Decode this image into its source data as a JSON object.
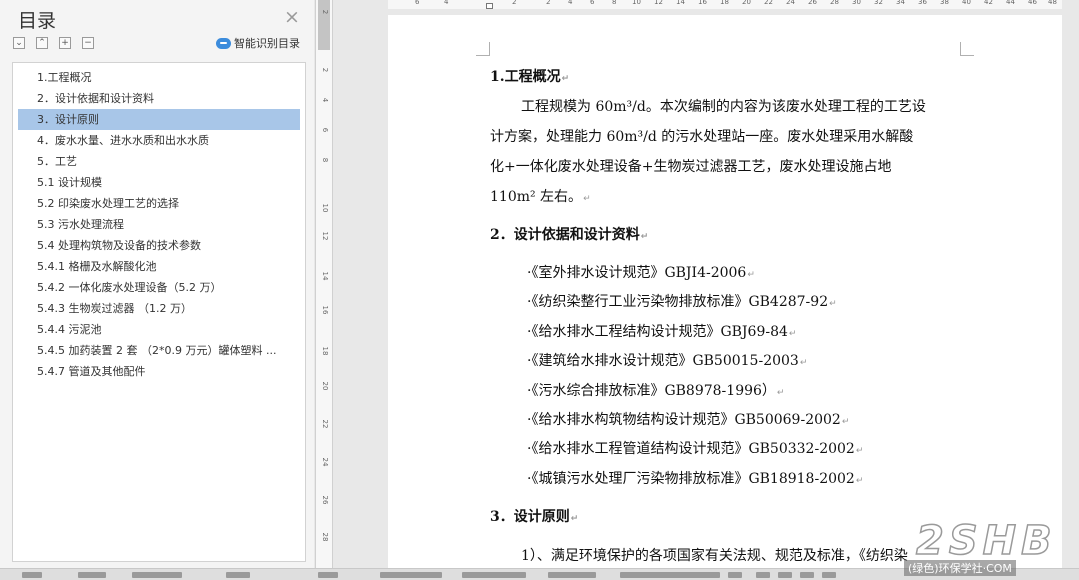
{
  "toc_panel": {
    "title": "目录",
    "close_icon": "×",
    "smart_toc_label": "智能识别目录",
    "buttons": [
      {
        "icon": "collapse-all-icon",
        "glyph": "⌄"
      },
      {
        "icon": "expand-up-icon",
        "glyph": "⌃"
      },
      {
        "icon": "add-heading-icon",
        "glyph": "+"
      },
      {
        "icon": "remove-heading-icon",
        "glyph": "−"
      }
    ],
    "items": [
      "1.工程概况",
      "2．设计依据和设计资料",
      "3．设计原则",
      "4．废水水量、进水水质和出水水质",
      "5．工艺",
      "5.1 设计规模",
      "5.2 印染废水处理工艺的选择",
      "5.3  污水处理流程",
      "5.4 处理构筑物及设备的技术参数",
      "5.4.1 格栅及水解酸化池",
      "5.4.2  一体化废水处理设备（5.2 万）",
      "5.4.3 生物炭过滤器 （1.2 万）",
      "5.4.4 污泥池",
      "5.4.5  加药装置 2 套  （2*0.9 万元）罐体塑料 ...",
      "5.4.7  管道及其他配件"
    ],
    "active_index": 2
  },
  "rulers": {
    "horizontal_labels": [
      "6",
      "4",
      "2",
      "2",
      "4",
      "6",
      "8",
      "10",
      "12",
      "14",
      "16",
      "18",
      "20",
      "22",
      "24",
      "26",
      "28",
      "30",
      "32",
      "34",
      "36",
      "38",
      "40",
      "42",
      "44",
      "46",
      "48"
    ],
    "vertical_labels": [
      "2",
      "2",
      "4",
      "6",
      "8",
      "10",
      "12",
      "14",
      "16",
      "18",
      "20",
      "22",
      "24",
      "26",
      "28"
    ]
  },
  "document": {
    "h1": "1.工程概况",
    "p1_lines": [
      "工程规模为 60m³/d。本次编制的内容为该废水处理工程的工艺设",
      "计方案，处理能力 60m³/d 的污水处理站一座。废水处理采用水解酸",
      "化+一体化废水处理设备+生物炭过滤器工艺，废水处理设施占地",
      "110m² 左右。"
    ],
    "h2": "2．设计依据和设计资料",
    "references": [
      "·《室外排水设计规范》GBJI4-2006",
      "·《纺织染整行工业污染物排放标准》GB4287-92",
      "·《给水排水工程结构设计规范》GBJ69-84",
      "·《建筑给水排水设计规范》GB50015-2003",
      "·《污水综合排放标准》GB8978-1996）",
      "·《给水排水构筑物结构设计规范》GB50069-2002",
      "·《给水排水工程管道结构设计规范》GB50332-2002",
      "·《城镇污水处理厂污染物排放标准》GB18918-2002"
    ],
    "h3": "3．设计原则",
    "p3_line": "1）、满足环境保护的各项国家有关法规、规范及标准，《纺织染",
    "paragraph_mark": "↵"
  },
  "watermark": {
    "logo": "2SHB",
    "text": "(绿色)环保学社·COM"
  },
  "colors": {
    "toc_highlight": "#a8c6e8",
    "smart_toc_icon": "#3c8cdc",
    "workspace": "#e8e8e8"
  }
}
